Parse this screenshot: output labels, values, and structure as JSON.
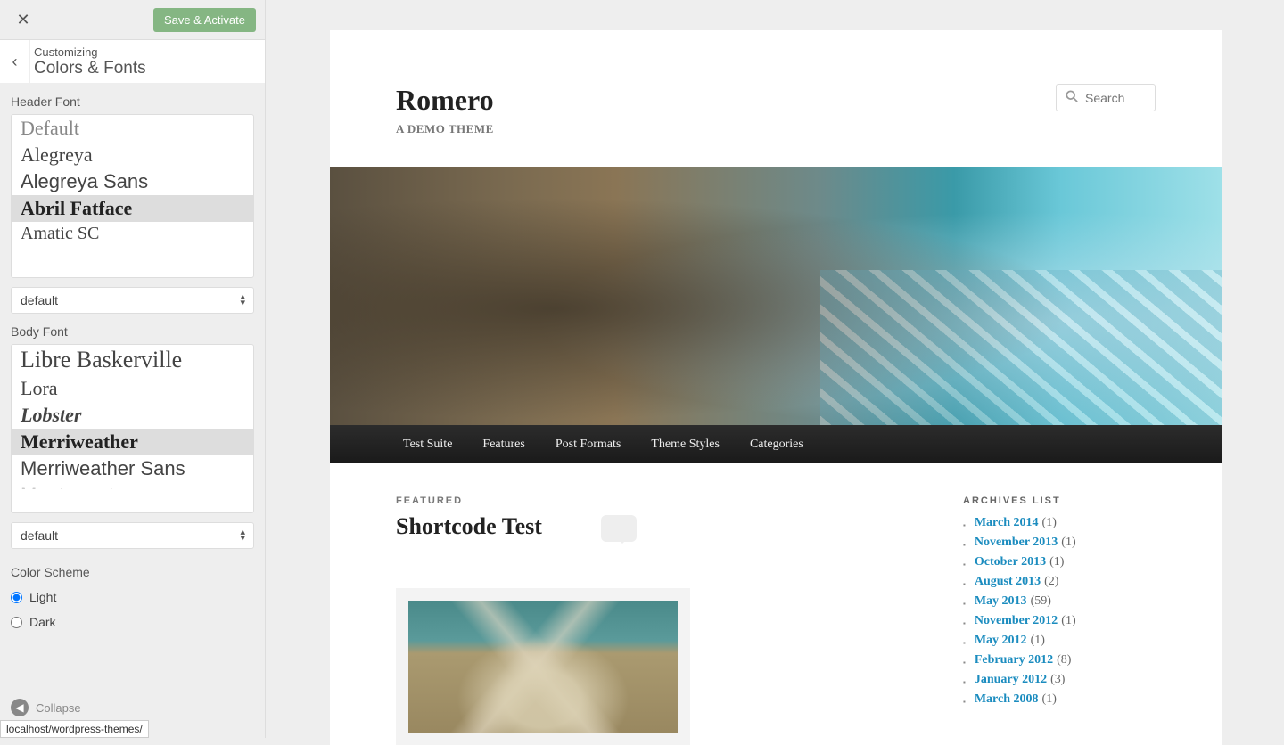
{
  "topbar": {
    "save_label": "Save & Activate"
  },
  "header": {
    "customizing": "Customizing",
    "section": "Colors & Fonts"
  },
  "header_font": {
    "label": "Header Font",
    "items": [
      "Default",
      "Alegreya",
      "Alegreya Sans",
      "Abril Fatface",
      "Amatic SC"
    ],
    "selected_index": 3,
    "dropdown_value": "default"
  },
  "body_font": {
    "label": "Body Font",
    "items": [
      "Libre Baskerville",
      "Lora",
      "Lobster",
      "Merriweather",
      "Merriweather Sans",
      "Montserrat"
    ],
    "selected_index": 3,
    "dropdown_value": "default"
  },
  "color_scheme": {
    "label": "Color Scheme",
    "options": [
      "Light",
      "Dark"
    ],
    "selected": "Light"
  },
  "collapse_label": "Collapse",
  "status_url": "localhost/wordpress-themes/",
  "preview": {
    "site_title": "Romero",
    "tagline": "A DEMO THEME",
    "search_placeholder": "Search",
    "nav": [
      "Test Suite",
      "Features",
      "Post Formats",
      "Theme Styles",
      "Categories"
    ],
    "post": {
      "featured": "FEATURED",
      "title": "Shortcode Test"
    },
    "archives_title": "ARCHIVES LIST",
    "archives": [
      {
        "label": "March 2014",
        "count": "(1)"
      },
      {
        "label": "November 2013",
        "count": "(1)"
      },
      {
        "label": "October 2013",
        "count": "(1)"
      },
      {
        "label": "August 2013",
        "count": "(2)"
      },
      {
        "label": "May 2013",
        "count": "(59)"
      },
      {
        "label": "November 2012",
        "count": "(1)"
      },
      {
        "label": "May 2012",
        "count": "(1)"
      },
      {
        "label": "February 2012",
        "count": "(8)"
      },
      {
        "label": "January 2012",
        "count": "(3)"
      },
      {
        "label": "March 2008",
        "count": "(1)"
      }
    ]
  }
}
